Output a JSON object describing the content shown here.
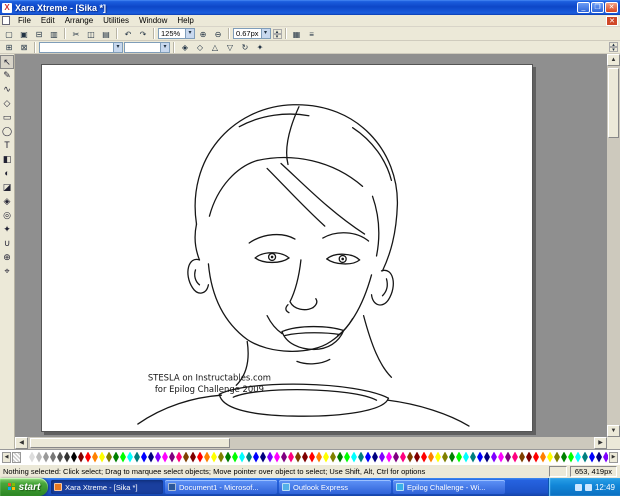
{
  "window": {
    "title": "Xara Xtreme - [Sika *]",
    "app_icon_glyph": "X",
    "controls": {
      "minimize": "_",
      "maximize": "❐",
      "close": "✕"
    }
  },
  "menu_bar": {
    "items": [
      "File",
      "Edit",
      "Arrange",
      "Utilities",
      "Window",
      "Help"
    ],
    "close_glyph": "✕"
  },
  "toolbar1": {
    "icons": {
      "new": "▢",
      "open": "▣",
      "save": "⊟",
      "print": "▥",
      "cut": "✂",
      "copy": "◫",
      "paste": "▤",
      "undo": "↶",
      "redo": "↷",
      "zoom_in": "⊕",
      "zoom_out": "⊖",
      "snap": "▦",
      "options": "≡"
    },
    "zoom_value": "125%",
    "width_value": "0.67px",
    "dropdown_glyph": "▾",
    "spin_up": "▴",
    "spin_down": "▾"
  },
  "toolbar2": {
    "icons": {
      "group": "⊞",
      "ungroup": "⊠",
      "front": "◈",
      "back": "◇",
      "flip_h": "△",
      "flip_v": "▽",
      "rotate": "↻",
      "effects": "✦"
    },
    "style_value": "",
    "size_value": "",
    "spin_up": "▴",
    "spin_down": "▾"
  },
  "toolbox": {
    "tools": [
      {
        "name": "selector-tool",
        "glyph": "↖"
      },
      {
        "name": "freehand-tool",
        "glyph": "✎"
      },
      {
        "name": "shape-editor-tool",
        "glyph": "∿"
      },
      {
        "name": "quickshape-tool",
        "glyph": "◇"
      },
      {
        "name": "rectangle-tool",
        "glyph": "▭"
      },
      {
        "name": "ellipse-tool",
        "glyph": "◯"
      },
      {
        "name": "text-tool",
        "glyph": "T"
      },
      {
        "name": "fill-tool",
        "glyph": "◧"
      },
      {
        "name": "transparency-tool",
        "glyph": "◐"
      },
      {
        "name": "shadow-tool",
        "glyph": "◪"
      },
      {
        "name": "bevel-tool",
        "glyph": "◈"
      },
      {
        "name": "contour-tool",
        "glyph": "◎"
      },
      {
        "name": "blend-tool",
        "glyph": "✦"
      },
      {
        "name": "mold-tool",
        "glyph": "∪"
      },
      {
        "name": "zoom-tool",
        "glyph": "⊕"
      },
      {
        "name": "push-tool",
        "glyph": "⌖"
      }
    ]
  },
  "canvas": {
    "scroll_up": "▲",
    "scroll_down": "▼",
    "scroll_left": "◀",
    "scroll_right": "▶"
  },
  "drawing": {
    "caption_line1": "STESLA on Instructables.com",
    "caption_line2": "for Epilog Challenge 2009"
  },
  "palette": {
    "left_arrow": "◀",
    "right_arrow": "▶",
    "colors": [
      "#ffffff",
      "#dddddd",
      "#bbbbbb",
      "#999999",
      "#777777",
      "#555555",
      "#333333",
      "#000000",
      "#800000",
      "#ff0000",
      "#ff8000",
      "#ffff00",
      "#808000",
      "#008000",
      "#00ff00",
      "#00ffff",
      "#008080",
      "#0000ff",
      "#000080",
      "#8000ff",
      "#ff00ff",
      "#800080",
      "#ff0080",
      "#804000",
      "#800000",
      "#ff0000",
      "#ff8000",
      "#ffff00",
      "#808000",
      "#008000",
      "#00ff00",
      "#00ffff",
      "#008080",
      "#0000ff",
      "#000080",
      "#8000ff",
      "#ff00ff",
      "#800080",
      "#ff0080",
      "#804000",
      "#800000",
      "#ff0000",
      "#ff8000",
      "#ffff00",
      "#808000",
      "#008000",
      "#00ff00",
      "#00ffff",
      "#008080",
      "#0000ff",
      "#000080",
      "#8000ff",
      "#ff00ff",
      "#800080",
      "#ff0080",
      "#804000",
      "#800000",
      "#ff0000",
      "#ff8000",
      "#ffff00",
      "#808000",
      "#008000",
      "#00ff00",
      "#00ffff",
      "#008080",
      "#0000ff",
      "#000080",
      "#8000ff",
      "#ff00ff",
      "#800080",
      "#ff0080",
      "#804000",
      "#800000",
      "#ff0000",
      "#ff8000",
      "#ffff00",
      "#808000",
      "#008000",
      "#00ff00",
      "#00ffff",
      "#008080",
      "#0000ff",
      "#000080",
      "#8000ff",
      "#ff00ff",
      "#800080",
      "#ff0080",
      "#804000"
    ]
  },
  "statusbar": {
    "message": "Nothing selected: Click select; Drag to marquee select objects; Move pointer over object to select; Use Shift, Alt, Ctrl for options",
    "pointer_position": "653, 419px"
  },
  "taskbar": {
    "start_label": "start",
    "buttons": [
      {
        "label": "Xara Xtreme - [Sika *]",
        "active": true,
        "icon_color": "#e87820"
      },
      {
        "label": "Document1 - Microsof...",
        "active": false,
        "icon_color": "#2b579a"
      },
      {
        "label": "Outlook Express",
        "active": false,
        "icon_color": "#53b0e8"
      },
      {
        "label": "Epilog Challenge - Wi...",
        "active": false,
        "icon_color": "#3ab0e8"
      }
    ],
    "clock": "12:49"
  }
}
